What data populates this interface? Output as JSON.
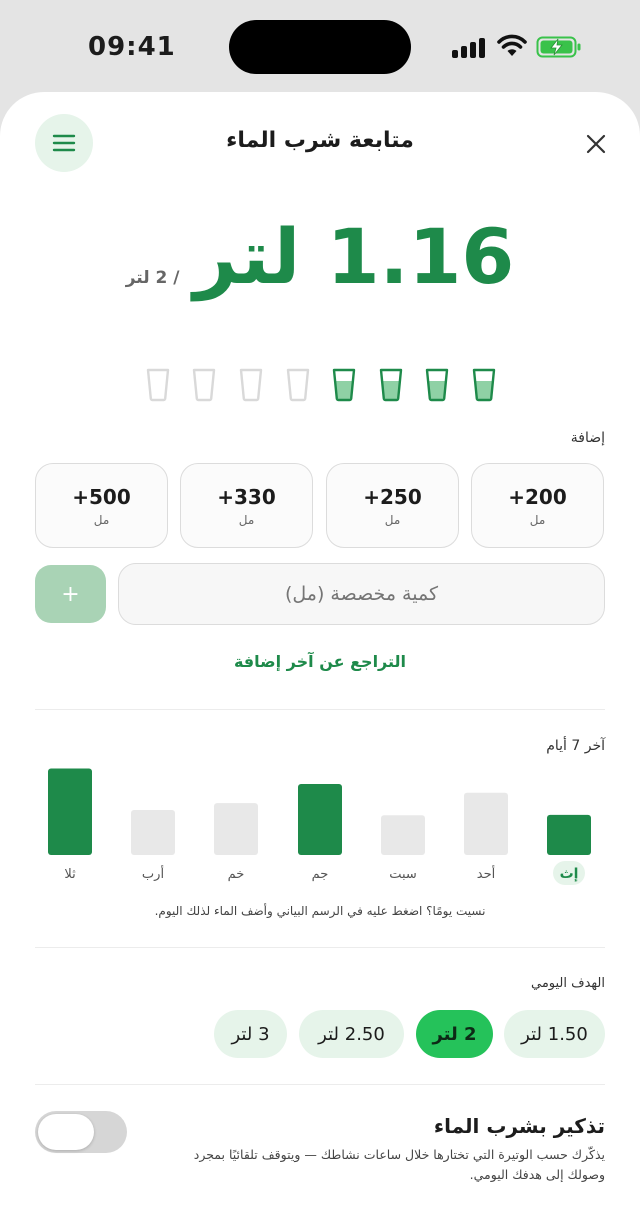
{
  "status": {
    "time": "09:41"
  },
  "header": {
    "title": "متابعة شرب الماء"
  },
  "intake": {
    "value": "1.16 لتر",
    "goal": "/ 2 لتر"
  },
  "cups": [
    {
      "filled": false
    },
    {
      "filled": false
    },
    {
      "filled": false
    },
    {
      "filled": false
    },
    {
      "filled": true
    },
    {
      "filled": true
    },
    {
      "filled": true
    },
    {
      "filled": true
    }
  ],
  "add_section": {
    "label": "إضافة",
    "quick": [
      {
        "value": "+200",
        "unit": "مل"
      },
      {
        "value": "+250",
        "unit": "مل"
      },
      {
        "value": "+330",
        "unit": "مل"
      },
      {
        "value": "+500",
        "unit": "مل"
      }
    ],
    "custom_placeholder": "كمية مخصصة (مل)",
    "plus_label": "+",
    "undo_label": "التراجع عن آخر إضافة"
  },
  "history": {
    "label": "آخر 7 أيام",
    "hint": "نسيت يومًا؟ اضغط عليه في الرسم البياني وأضف الماء لذلك اليوم."
  },
  "chart_data": {
    "type": "bar",
    "categories": [
      "إث",
      "أحد",
      "سبت",
      "جم",
      "خم",
      "أرب",
      "ثلا"
    ],
    "values": [
      1.16,
      1.8,
      1.15,
      2.05,
      1.5,
      1.3,
      2.5
    ],
    "selected": "إث",
    "goal_reached": [
      true,
      false,
      false,
      true,
      false,
      false,
      true
    ],
    "ylim": [
      0,
      2.6
    ],
    "colors": {
      "met": "#1e8a4a",
      "unmet": "#e8e8e8"
    }
  },
  "goal": {
    "label": "الهدف اليومي",
    "options": [
      "1.50 لتر",
      "2 لتر",
      "2.50 لتر",
      "3 لتر"
    ],
    "selected_index": 1
  },
  "reminder": {
    "title": "تذكير بشرب الماء",
    "description": "يذكّرك حسب الوتيرة التي تختارها خلال ساعات نشاطك — ويتوقف تلقائيًا بمجرد وصولك إلى هدفك اليومي.",
    "enabled": false
  },
  "colors": {
    "accent": "#1e8a4a",
    "accent_light": "#e6f4ea",
    "active_pill": "#25c25a"
  }
}
